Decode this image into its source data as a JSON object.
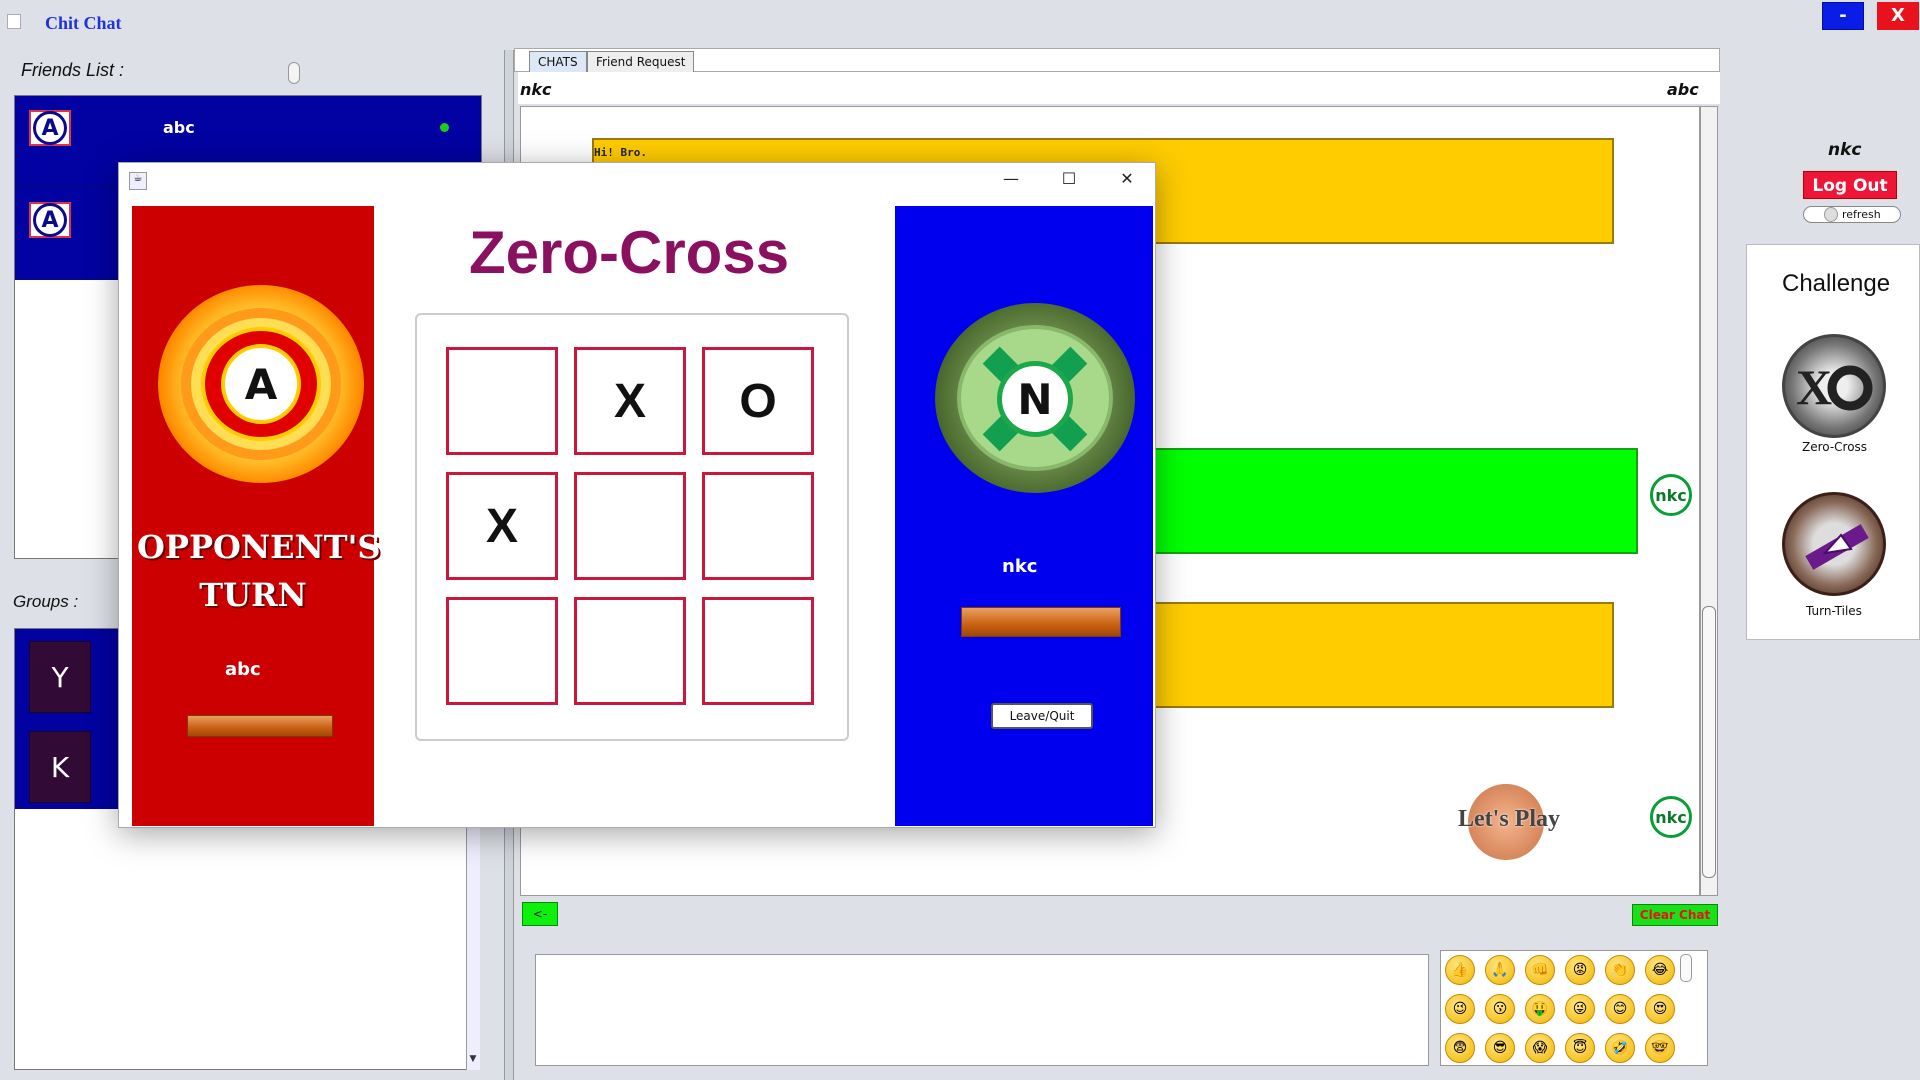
{
  "app": {
    "title": "Chit Chat",
    "minimize_label": "-",
    "close_label": "X"
  },
  "friends": {
    "label": "Friends List :",
    "items": [
      {
        "initial": "A",
        "name": "abc",
        "online": true
      },
      {
        "initial": "A",
        "name": "",
        "online": false
      }
    ]
  },
  "groups": {
    "label": "Groups :",
    "items": [
      {
        "initial": "Y"
      },
      {
        "initial": "K"
      }
    ]
  },
  "chat": {
    "tabs": [
      "CHATS",
      "Friend Request"
    ],
    "left_user": "nkc",
    "right_user": "abc",
    "messages": [
      {
        "text": "Hi! Bro.",
        "color": "#ffcc00"
      },
      {
        "text": "",
        "color": "#00ff00"
      },
      {
        "text": "",
        "color": "#ffcc00"
      }
    ],
    "badges": [
      "nkc",
      "nkc"
    ],
    "lets_play": "Let's Play",
    "back_label": "<-",
    "clear_label": "Clear Chat",
    "emoji_icons": [
      "like-icon",
      "pray-icon",
      "fist-icon",
      "angry-icon",
      "clap-icon",
      "laugh-icon",
      "wink-icon",
      "kiss-icon",
      "money-icon",
      "silly-icon",
      "smile-icon",
      "heart-eyes-icon",
      "fear-icon",
      "cool-icon",
      "scream-icon",
      "angel-icon",
      "rofl-icon",
      "nerd-icon"
    ]
  },
  "user_panel": {
    "current_user": "nkc",
    "logout_label": "Log Out",
    "refresh_label": "refresh"
  },
  "challenge": {
    "title": "Challenge",
    "games": [
      "Zero-Cross",
      "Turn-Tiles"
    ]
  },
  "game_window": {
    "title": "Zero-Cross",
    "window_controls": [
      "—",
      "☐",
      "✕"
    ],
    "turn_text": "OPPONENT'S TURN",
    "opponent": {
      "initial": "A",
      "name": "abc",
      "color": "#cc0000"
    },
    "player": {
      "initial": "N",
      "name": "nkc",
      "color": "#0000ee"
    },
    "leave_label": "Leave/Quit",
    "board": [
      "",
      "X",
      "O",
      "X",
      "",
      "",
      "",
      "",
      ""
    ]
  }
}
